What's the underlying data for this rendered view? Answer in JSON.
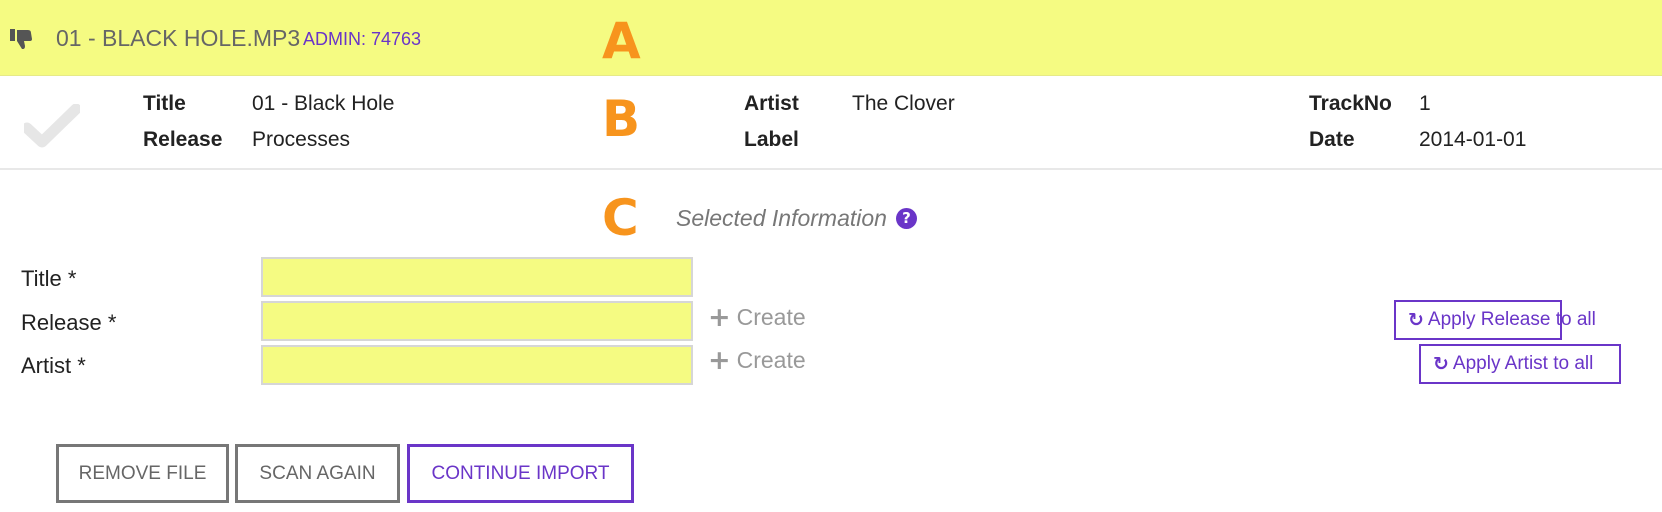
{
  "header": {
    "file_name": "01 - BLACK HOLE.MP3",
    "admin_tag": "ADMIN: 74763",
    "status_icon": "thumbs-down-icon",
    "background_color": "#f5fb82"
  },
  "markers": {
    "a": "A",
    "b": "B",
    "c": "C",
    "color": "#f7941d"
  },
  "metadata": {
    "status_icon": "checkmark-icon",
    "title_label": "Title",
    "title_value": "01 - Black Hole",
    "release_label": "Release",
    "release_value": "Processes",
    "artist_label": "Artist",
    "artist_value": "The Clover",
    "label_label": "Label",
    "label_value": "",
    "trackno_label": "TrackNo",
    "trackno_value": "1",
    "date_label": "Date",
    "date_value": "2014-01-01"
  },
  "selected": {
    "heading": "Selected Information",
    "help_icon": "?"
  },
  "form": {
    "title_label": "Title *",
    "title_value": "",
    "release_label": "Release *",
    "release_value": "",
    "artist_label": "Artist *",
    "artist_value": "",
    "create_label": "Create",
    "apply_release": "Apply Release to all",
    "apply_artist": "Apply Artist to all",
    "field_color": "#f5fb82"
  },
  "actions": {
    "remove": "REMOVE FILE",
    "scan": "SCAN AGAIN",
    "continue": "CONTINUE IMPORT",
    "accent_color": "#6a35c8"
  }
}
